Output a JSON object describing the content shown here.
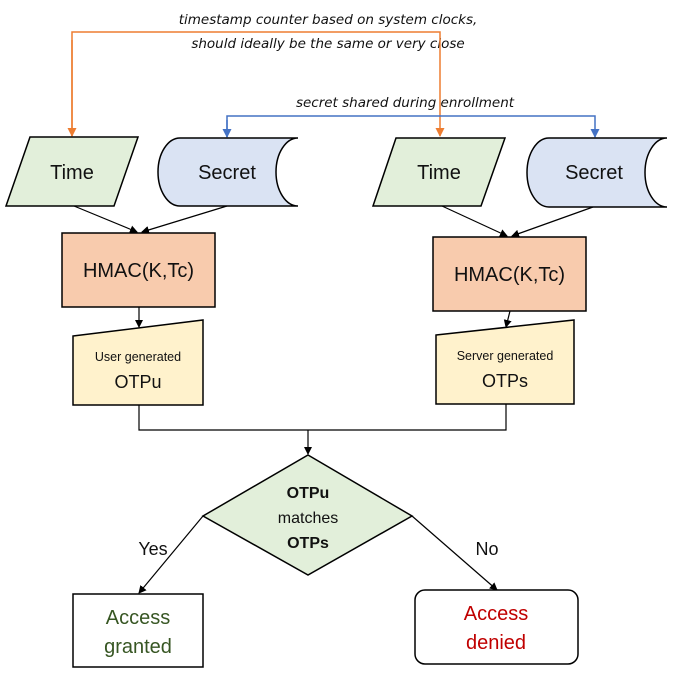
{
  "annotations": {
    "timestamp_note_line1": "timestamp counter based on system clocks,",
    "timestamp_note_line2": "should ideally be the same or very close",
    "secret_note": "secret shared during enrollment"
  },
  "colors": {
    "time_connector": "#ED7D31",
    "secret_connector": "#4472C4",
    "time_fill": "#E2EFDA",
    "secret_fill": "#DAE3F3",
    "hmac_fill": "#F8CBAD",
    "otp_fill": "#FFF2CC",
    "decision_fill": "#E2EFDA",
    "granted_text": "#375623",
    "denied_text": "#C00000"
  },
  "user_side": {
    "time_label": "Time",
    "secret_label": "Secret",
    "hmac_label": "HMAC(K,Tc)",
    "otp_caption": "User generated",
    "otp_label": "OTPu"
  },
  "server_side": {
    "time_label": "Time",
    "secret_label": "Secret",
    "hmac_label": "HMAC(K,Tc)",
    "otp_caption": "Server generated",
    "otp_label": "OTPs"
  },
  "decision": {
    "line1": "OTPu",
    "line2": "matches",
    "line3": "OTPs",
    "yes_label": "Yes",
    "no_label": "No"
  },
  "outcomes": {
    "granted_line1": "Access",
    "granted_line2": "granted",
    "denied_line1": "Access",
    "denied_line2": "denied"
  }
}
